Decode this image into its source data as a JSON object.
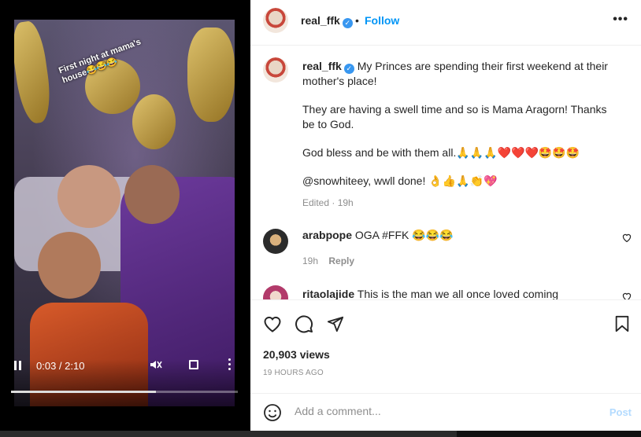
{
  "video": {
    "caption_overlay": "First night at mama's house😂😂😂",
    "time_display": "0:03 / 2:10",
    "progress_fraction": 0.64
  },
  "post": {
    "author": "real_ffk",
    "follow_label": "Follow",
    "separator": "•",
    "more_label": "•••",
    "caption": {
      "p1": "My Princes are spending their first weekend at their mother's place!",
      "p2": "They are having a swell time and so is Mama Aragorn! Thanks be to God.",
      "p3": "God bless and be with them all.🙏🙏🙏❤️❤️❤️🤩🤩🤩",
      "p4": "@snowhiteey, wwll done! 👌👍🙏👏💖"
    },
    "caption_meta": "Edited · 19h",
    "views": "20,903 views",
    "time_ago": "19 HOURS AGO"
  },
  "comments": [
    {
      "user": "arabpope",
      "text": "OGA #FFK 😂😂😂",
      "time": "19h",
      "reply_label": "Reply"
    },
    {
      "user": "ritaolajide",
      "text": "This is the man we all once loved coming"
    }
  ],
  "add_comment": {
    "placeholder": "Add a comment...",
    "post_label": "Post"
  },
  "icons": {
    "like": "heart-icon",
    "comment": "comment-icon",
    "share": "share-icon",
    "save": "bookmark-icon",
    "emoji": "emoji-icon",
    "verified": "verified-badge-icon",
    "pause": "pause-icon",
    "mute": "mute-icon",
    "fullscreen": "fullscreen-icon"
  },
  "colors": {
    "accent": "#0095f6",
    "verified": "#3897f0",
    "post_disabled": "#b3dbff"
  }
}
